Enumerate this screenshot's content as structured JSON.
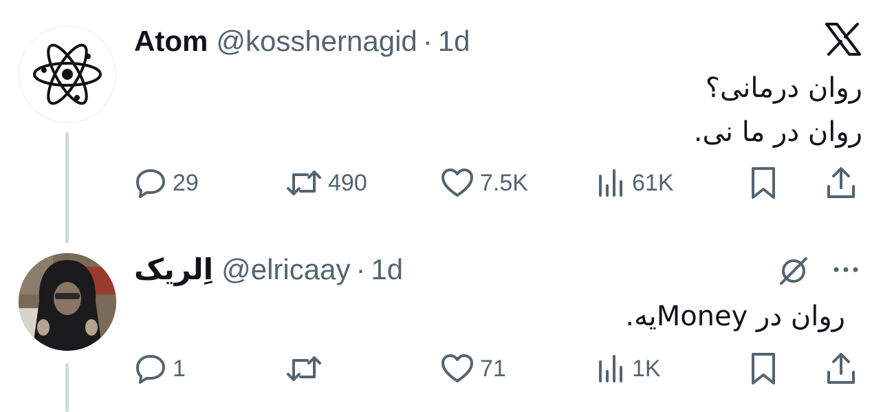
{
  "platform": {
    "logo_icon": "x-logo-icon"
  },
  "tweets": [
    {
      "display_name": "Atom",
      "handle": "@kosshernagid",
      "separator": "·",
      "time": "1d",
      "avatar_icon": "atom-icon",
      "text_lines": [
        "روان درمانی؟",
        "روان در ما نی."
      ],
      "stats": {
        "replies": "29",
        "reposts": "490",
        "likes": "7.5K",
        "views": "61K"
      }
    },
    {
      "display_name": "اِلریک",
      "handle": "@elricaay",
      "separator": "·",
      "time": "1d",
      "avatar_icon": "hooded-person-avatar",
      "text_lines": [
        "روان در Moneyیه."
      ],
      "stats": {
        "replies": "1",
        "reposts": "",
        "likes": "71",
        "views": "1K"
      }
    }
  ],
  "colors": {
    "text_primary": "#0f1419",
    "text_secondary": "#536471",
    "thread_line": "#cfd9de"
  }
}
